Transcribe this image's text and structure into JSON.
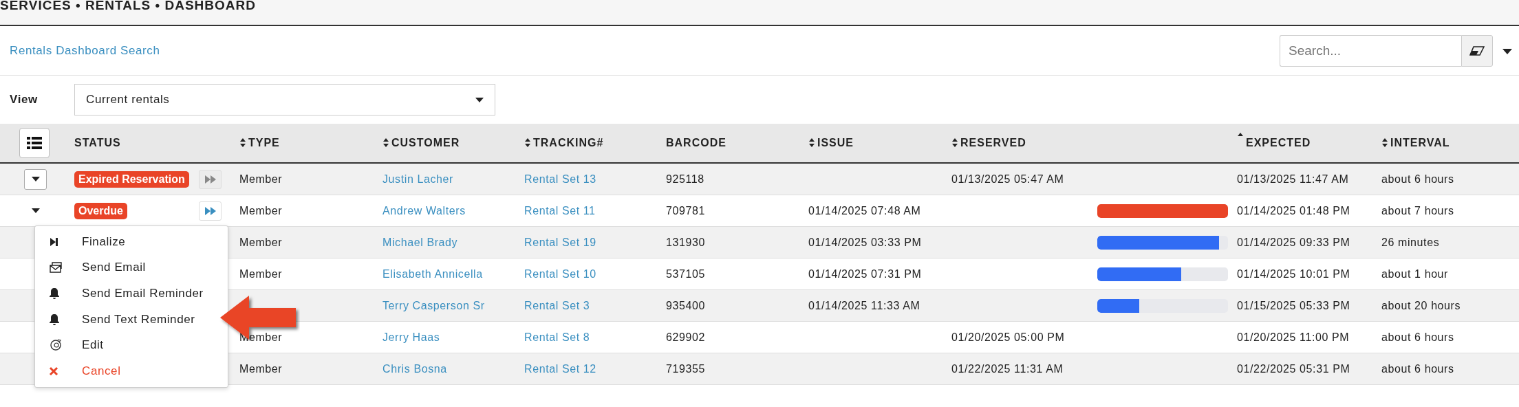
{
  "breadcrumb": "SERVICES • RENTALS • DASHBOARD",
  "search_link": "Rentals Dashboard Search",
  "search": {
    "placeholder": "Search..."
  },
  "view": {
    "label": "View",
    "value": "Current rentals"
  },
  "columns": [
    {
      "label": "STATUS"
    },
    {
      "label": "TYPE",
      "sort_up": true,
      "sort_down": true
    },
    {
      "label": "CUSTOMER",
      "sort_up": true,
      "sort_down": true
    },
    {
      "label": "TRACKING#",
      "sort_up": true,
      "sort_down": true
    },
    {
      "label": "BARCODE"
    },
    {
      "label": "ISSUE",
      "sort_up": true,
      "sort_down": true
    },
    {
      "label": "RESERVED",
      "sort_up": true,
      "sort_down": true
    },
    {
      "label": "EXPECTED",
      "sort_up": true,
      "sort_down": false
    },
    {
      "label": "INTERVAL",
      "sort_up": true,
      "sort_down": true
    }
  ],
  "rows": [
    {
      "expanded": false,
      "status": "Expired Reservation",
      "forward_active": false,
      "type": "Member",
      "customer": "Justin Lacher",
      "tracking": "Rental Set 13",
      "barcode": "925118",
      "reserved": "01/13/2025 05:47 AM",
      "expected": "01/13/2025 11:47 AM",
      "interval": "about 6 hours"
    },
    {
      "expanded": true,
      "status": "Overdue",
      "forward_active": true,
      "type": "Member",
      "customer": "Andrew Walters",
      "tracking": "Rental Set 11",
      "barcode": "709781",
      "issue": "01/14/2025 07:48 AM",
      "progress": {
        "level": 1,
        "color": "#e94427"
      },
      "expected": "01/14/2025 01:48 PM",
      "interval": "about 7 hours"
    },
    {
      "type": "Member",
      "customer": "Michael Brady",
      "tracking": "Rental Set 19",
      "barcode": "131930",
      "issue": "01/14/2025 03:33 PM",
      "progress": {
        "level": 0.93,
        "color": "#316cf4"
      },
      "expected": "01/14/2025 09:33 PM",
      "interval": "26 minutes"
    },
    {
      "type": "Member",
      "customer": "Elisabeth Annicella",
      "tracking": "Rental Set 10",
      "barcode": "537105",
      "issue": "01/14/2025 07:31 PM",
      "progress": {
        "level": 0.64,
        "color": "#316cf4"
      },
      "expected": "01/14/2025 10:01 PM",
      "interval": "about 1 hour"
    },
    {
      "customer": "Terry Casperson Sr",
      "tracking": "Rental Set 3",
      "barcode": "935400",
      "issue": "01/14/2025 11:33 AM",
      "progress": {
        "level": 0.32,
        "color": "#316cf4"
      },
      "expected": "01/15/2025 05:33 PM",
      "interval": "about 20 hours"
    },
    {
      "type": "Member",
      "customer": "Jerry Haas",
      "tracking": "Rental Set 8",
      "barcode": "629902",
      "reserved": "01/20/2025 05:00 PM",
      "expected": "01/20/2025 11:00 PM",
      "interval": "about 6 hours"
    },
    {
      "type": "Member",
      "customer": "Chris Bosna",
      "tracking": "Rental Set 12",
      "barcode": "719355",
      "reserved": "01/22/2025 11:31 AM",
      "expected": "01/22/2025 05:31 PM",
      "interval": "about 6 hours"
    }
  ],
  "menu": [
    {
      "kind": "finalize",
      "label": "Finalize"
    },
    {
      "kind": "email",
      "label": "Send Email"
    },
    {
      "kind": "bell",
      "label": "Send Email Reminder"
    },
    {
      "kind": "bell",
      "label": "Send Text Reminder"
    },
    {
      "kind": "edit",
      "label": "Edit"
    },
    {
      "kind": "cancel",
      "label": "Cancel"
    }
  ]
}
